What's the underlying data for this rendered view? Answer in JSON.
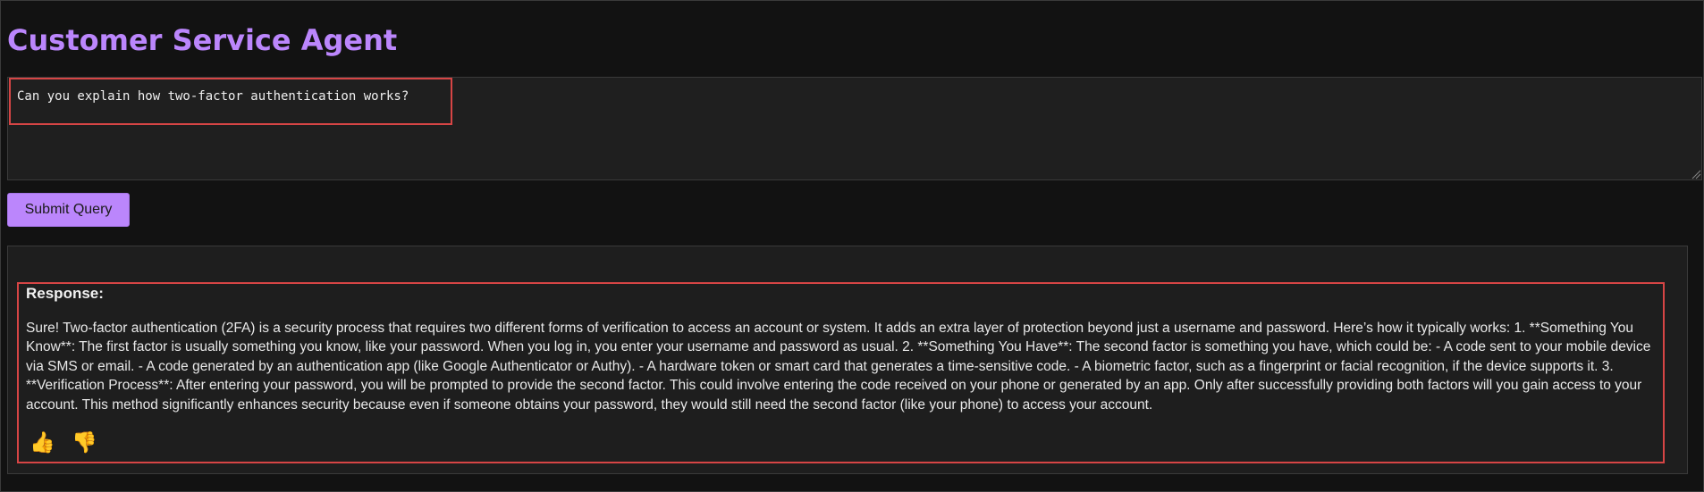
{
  "app": {
    "title": "Customer Service Agent"
  },
  "query": {
    "value": "Can you explain how two-factor authentication works?"
  },
  "submit": {
    "label": "Submit Query"
  },
  "response": {
    "heading": "Response:",
    "body": "Sure! Two-factor authentication (2FA) is a security process that requires two different forms of verification to access an account or system. It adds an extra layer of protection beyond just a username and password. Here’s how it typically works: 1. **Something You Know**: The first factor is usually something you know, like your password. When you log in, you enter your username and password as usual. 2. **Something You Have**: The second factor is something you have, which could be: - A code sent to your mobile device via SMS or email. - A code generated by an authentication app (like Google Authenticator or Authy). - A hardware token or smart card that generates a time-sensitive code. - A biometric factor, such as a fingerprint or facial recognition, if the device supports it. 3. **Verification Process**: After entering your password, you will be prompted to provide the second factor. This could involve entering the code received on your phone or generated by an app. Only after successfully providing both factors will you gain access to your account. This method significantly enhances security because even if someone obtains your password, they would still need the second factor (like your phone) to access your account."
  },
  "feedback": {
    "thumbs_up_icon": "👍",
    "thumbs_down_icon": "👎"
  },
  "colors": {
    "background": "#121212",
    "accent": "#bb86fc",
    "highlight": "#d64545",
    "panel": "#1e1e1e"
  }
}
